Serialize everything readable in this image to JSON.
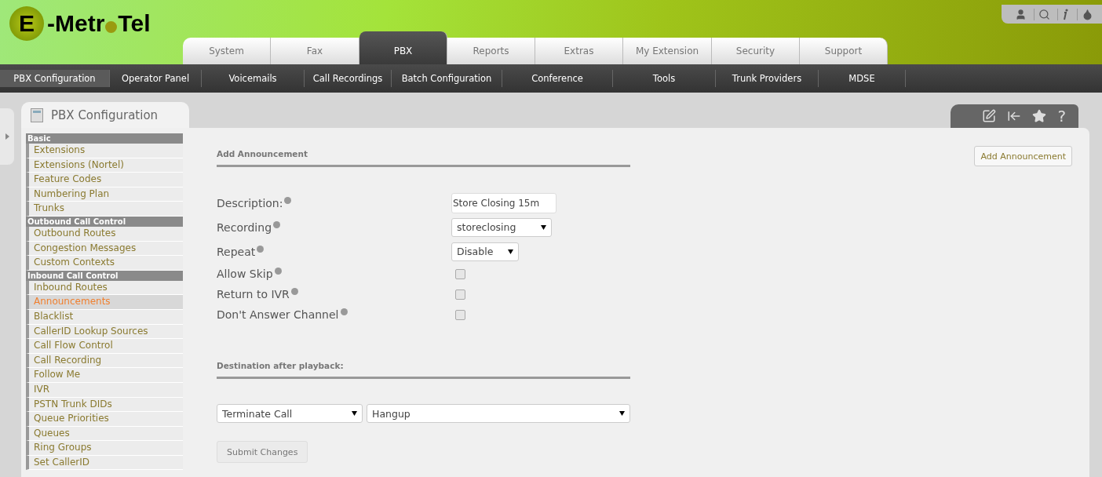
{
  "logo": {
    "letter": "E",
    "part1": "-Metr",
    "part2": "Tel"
  },
  "tabs": [
    {
      "label": "System",
      "selected": false
    },
    {
      "label": "Fax",
      "selected": false
    },
    {
      "label": "PBX",
      "selected": true
    },
    {
      "label": "Reports",
      "selected": false
    },
    {
      "label": "Extras",
      "selected": false
    },
    {
      "label": "My Extension",
      "selected": false
    },
    {
      "label": "Security",
      "selected": false
    },
    {
      "label": "Support",
      "selected": false
    }
  ],
  "subnav": [
    {
      "label": "PBX Configuration",
      "selected": true
    },
    {
      "label": "Operator Panel",
      "selected": false
    },
    {
      "label": "Voicemails",
      "selected": false
    },
    {
      "label": "Call Recordings",
      "selected": false
    },
    {
      "label": "Batch Configuration",
      "selected": false
    },
    {
      "label": "Conference",
      "selected": false
    },
    {
      "label": "Tools",
      "selected": false
    },
    {
      "label": "Trunk Providers",
      "selected": false
    },
    {
      "label": "MDSE",
      "selected": false
    }
  ],
  "panel": {
    "title": "PBX Configuration",
    "help_glyph": "?",
    "add_button": "Add Announcement"
  },
  "sidebar": [
    {
      "header": "Basic",
      "items": [
        {
          "label": "Extensions",
          "selected": false
        },
        {
          "label": "Extensions (Nortel)",
          "selected": false
        },
        {
          "label": "Feature Codes",
          "selected": false
        },
        {
          "label": "Numbering Plan",
          "selected": false
        },
        {
          "label": "Trunks",
          "selected": false
        }
      ]
    },
    {
      "header": "Outbound Call Control",
      "items": [
        {
          "label": "Outbound Routes",
          "selected": false
        },
        {
          "label": "Congestion Messages",
          "selected": false
        },
        {
          "label": "Custom Contexts",
          "selected": false
        }
      ]
    },
    {
      "header": "Inbound Call Control",
      "items": [
        {
          "label": "Inbound Routes",
          "selected": false
        },
        {
          "label": "Announcements",
          "selected": true
        },
        {
          "label": "Blacklist",
          "selected": false
        },
        {
          "label": "CallerID Lookup Sources",
          "selected": false
        },
        {
          "label": "Call Flow Control",
          "selected": false
        },
        {
          "label": "Call Recording",
          "selected": false
        },
        {
          "label": "Follow Me",
          "selected": false
        },
        {
          "label": "IVR",
          "selected": false
        },
        {
          "label": "PSTN Trunk DIDs",
          "selected": false
        },
        {
          "label": "Queue Priorities",
          "selected": false
        },
        {
          "label": "Queues",
          "selected": false
        },
        {
          "label": "Ring Groups",
          "selected": false
        },
        {
          "label": "Set CallerID",
          "selected": false
        }
      ]
    }
  ],
  "form": {
    "section_title": "Add Announcement",
    "fields": [
      {
        "kind": "text",
        "label": "Description:",
        "value": "Store Closing 15m"
      },
      {
        "kind": "select",
        "label": "Recording",
        "value": "storeclosing"
      },
      {
        "kind": "select",
        "label": "Repeat",
        "value": "Disable"
      },
      {
        "kind": "checkbox",
        "label": "Allow Skip",
        "checked": false
      },
      {
        "kind": "checkbox",
        "label": "Return to IVR",
        "checked": false
      },
      {
        "kind": "checkbox",
        "label": "Don't Answer Channel",
        "checked": false
      }
    ],
    "destination_title": "Destination after playback:",
    "destination_type": "Terminate Call",
    "destination": "Hangup",
    "submit": "Submit Changes"
  }
}
